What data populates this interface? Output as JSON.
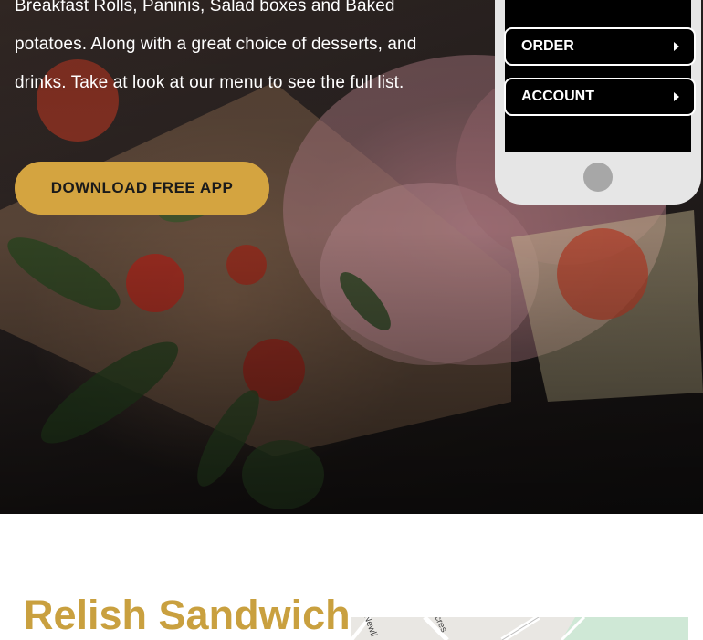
{
  "hero": {
    "paragraph_lines": [
      "Breakfast Rolls, Paninis, Salad boxes and Baked",
      "potatoes.  Along with a great choice of desserts, and",
      "drinks. Take at look at our menu to see the full list."
    ],
    "cta_label": "DOWNLOAD FREE APP"
  },
  "phone": {
    "buttons": [
      {
        "label": "ORDER",
        "icon": "caret-right-icon"
      },
      {
        "label": "ACCOUNT",
        "icon": "caret-right-icon"
      }
    ],
    "home_button_icon": "home-button"
  },
  "location": {
    "title": "Relish Sandwich",
    "map_streets": [
      "Newli",
      "cres"
    ]
  },
  "colors": {
    "accent": "#d4a440",
    "title": "#c9a03f",
    "phone_screen": "#000000",
    "phone_body": "#e6e6e6"
  }
}
